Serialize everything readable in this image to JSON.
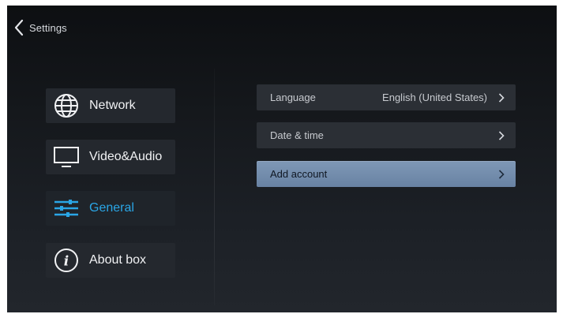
{
  "header": {
    "title": "Settings",
    "back_icon": "chevron-left-icon"
  },
  "sidebar": {
    "items": [
      {
        "label": "Network",
        "icon": "globe-icon",
        "active": false
      },
      {
        "label": "Video&Audio",
        "icon": "monitor-icon",
        "active": false
      },
      {
        "label": "General",
        "icon": "sliders-icon",
        "active": true
      },
      {
        "label": "About box",
        "icon": "info-icon",
        "active": false
      }
    ]
  },
  "main": {
    "rows": [
      {
        "label": "Language",
        "value": "English (United States)",
        "icon": "chevron-right-icon"
      },
      {
        "label": "Date & time",
        "icon": "chevron-right-icon"
      },
      {
        "label": "Add account",
        "icon": "chevron-right-icon",
        "selected": true
      }
    ]
  },
  "colors": {
    "accent": "#2aa6e6",
    "selected_row": "#7590b0",
    "background": "#15181c",
    "item_background": "#24282e"
  }
}
